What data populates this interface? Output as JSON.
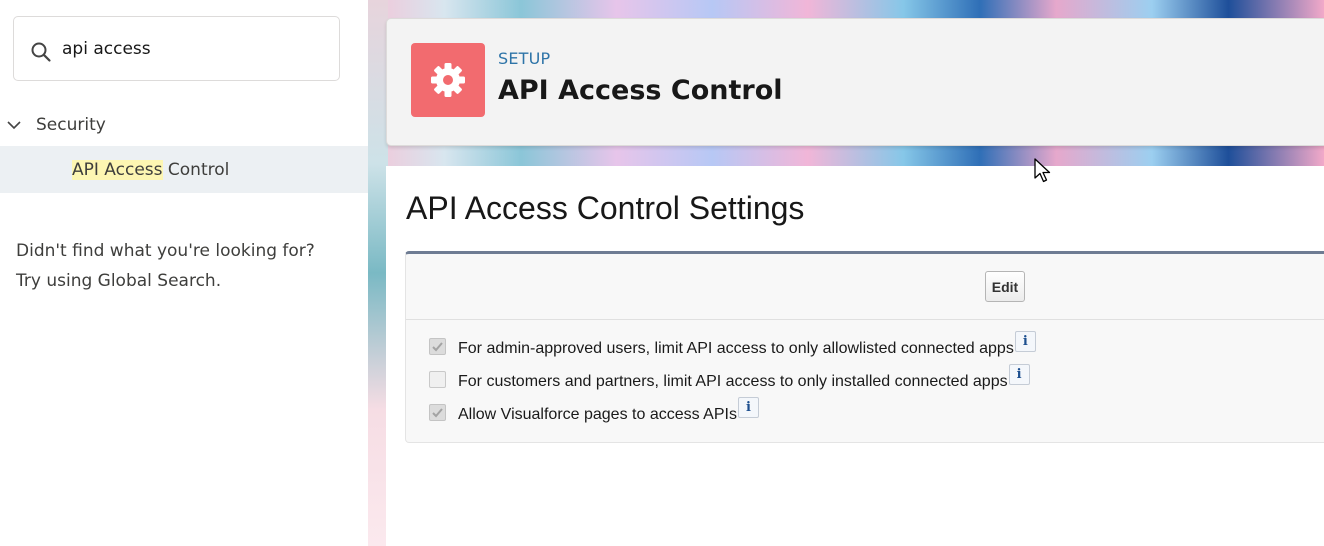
{
  "sidebar": {
    "search": {
      "value": "api access",
      "icon": "search-icon"
    },
    "group": {
      "label": "Security",
      "icon": "chevron-down-icon"
    },
    "item": {
      "highlight": "API Access",
      "rest": " Control"
    },
    "not_found": {
      "line1": "Didn't find what you're looking for?",
      "line2": "Try using Global Search."
    }
  },
  "header": {
    "eyebrow": "SETUP",
    "title": "API Access Control",
    "icon": "gear-icon",
    "icon_color": "#f26b6f"
  },
  "content": {
    "title": "API Access Control Settings",
    "edit_label": "Edit",
    "settings": [
      {
        "label": "For admin-approved users, limit API access to only allowlisted connected apps",
        "checked": true,
        "info": "i"
      },
      {
        "label": "For customers and partners, limit API access to only installed connected apps",
        "checked": false,
        "info": "i"
      },
      {
        "label": "Allow Visualforce pages to access APIs",
        "checked": true,
        "info": "i"
      }
    ]
  },
  "colors": {
    "accent_blue": "#2e74a8",
    "highlight": "#fdf6b2",
    "selected_row": "#ecf0f3"
  }
}
